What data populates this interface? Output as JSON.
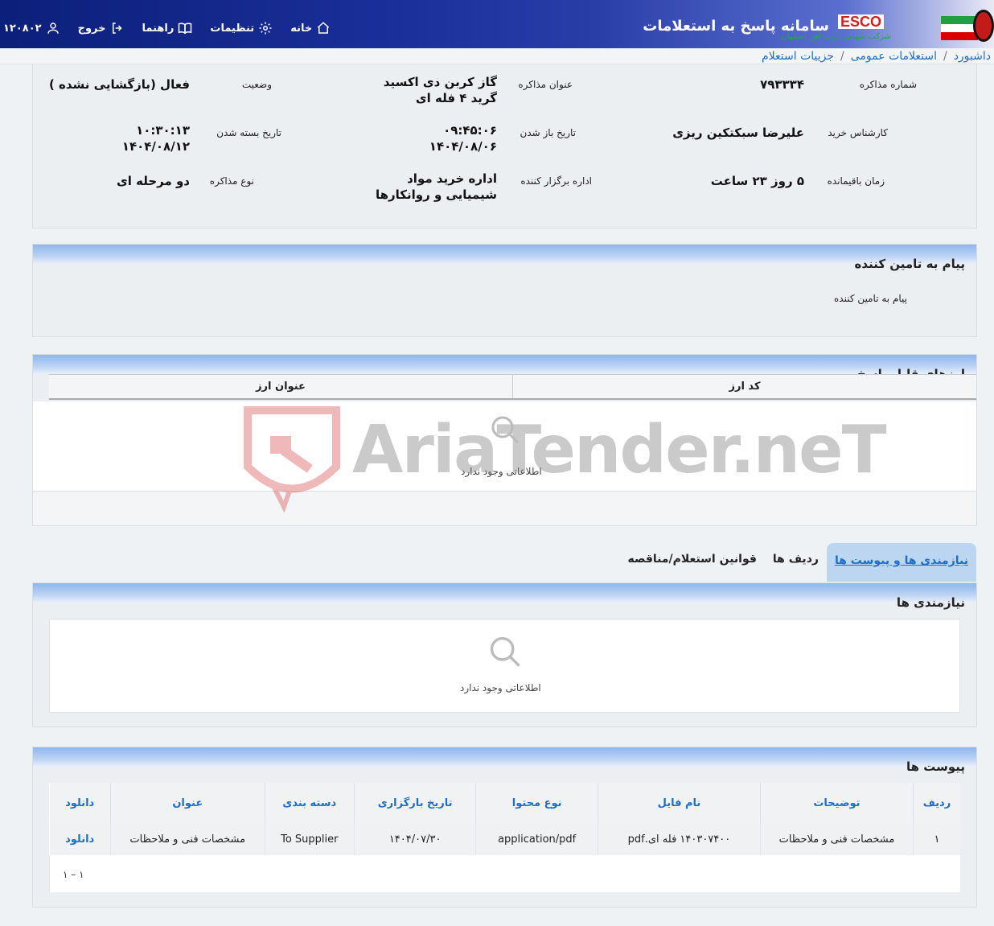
{
  "header": {
    "app_title": "سامانه پاسخ به استعلامات",
    "logo_text": "ESCO",
    "logo_subtitle": "شرکت سهامی ذوب آهن اصفهان",
    "nav": [
      {
        "label": "۱۲۰۸۰۲",
        "icon": "user-icon"
      },
      {
        "label": "خروج",
        "icon": "logout-icon"
      },
      {
        "label": "راهنما",
        "icon": "book-icon"
      },
      {
        "label": "تنظیمات",
        "icon": "gear-icon"
      },
      {
        "label": "خانه",
        "icon": "home-icon"
      }
    ]
  },
  "breadcrumb": [
    "داشبورد",
    "استعلامات عمومی",
    "جزییات استعلام"
  ],
  "details": {
    "negotiation_number": {
      "label": "شماره مذاکره",
      "value": "۷۹۳۳۳۴"
    },
    "negotiation_title": {
      "label": "عنوان مذاکره",
      "value": "گاز کربن دی اکسید گرید ۴ فله ای"
    },
    "status": {
      "label": "وضعیت",
      "value": "فعال (بازگشایی نشده )"
    },
    "buyer_expert": {
      "label": "کارشناس خرید",
      "value": "علیرضا سبکتکین ریزی"
    },
    "open_date": {
      "label": "تاریخ باز شدن",
      "time": "۰۹:۴۵:۰۶",
      "date": "۱۴۰۴/۰۸/۰۶"
    },
    "close_date": {
      "label": "تاریخ بسته شدن",
      "time": "۱۰:۳۰:۱۳",
      "date": "۱۴۰۴/۰۸/۱۲"
    },
    "remaining_time": {
      "label": "زمان باقیمانده",
      "value": "۵ روز ۲۳ ساعت"
    },
    "organizer": {
      "label": "اداره برگزار کننده",
      "value": "اداره خرید مواد شیمیایی و روانکارها"
    },
    "negotiation_type": {
      "label": "نوع مذاکره",
      "value": "دو مرحله ای"
    }
  },
  "message_panel": {
    "title": "پیام به تامین کننده",
    "body": "پیام به تامین کننده"
  },
  "currency_panel": {
    "title": "ارزهای قابل پاسخ",
    "columns": [
      "کد ارز",
      "عنوان ارز"
    ],
    "empty_text": "اطلاعاتی وجود ندارد"
  },
  "watermark": "AriaTender.neT",
  "tabs": [
    {
      "label": "نیازمندی ها و پیوست ها",
      "active": true
    },
    {
      "label": "ردیف ها",
      "active": false
    },
    {
      "label": "قوانین استعلام/مناقصه",
      "active": false
    }
  ],
  "needs_panel": {
    "title": "نیازمندی ها",
    "empty_text": "اطلاعاتی وجود ندارد"
  },
  "attachments_panel": {
    "title": "پیوست ها",
    "columns": [
      "ردیف",
      "توضیحات",
      "نام فایل",
      "نوع محتوا",
      "تاریخ بارگزاری",
      "دسته بندی",
      "عنوان",
      "دانلود"
    ],
    "rows": [
      {
        "row": "۱",
        "description": "مشخصات فنی و ملاحظات",
        "file_name": "۱۴۰۳۰۷۴۰۰ فله ای.pdf",
        "content_type": "application/pdf",
        "upload_date": "۱۴۰۴/۰۷/۳۰",
        "category": "To Supplier",
        "title": "مشخصات فنی و ملاحظات",
        "download": "دانلود"
      }
    ],
    "pager": "۱ – ۱"
  },
  "colors": {
    "accent": "#1e6ec8",
    "header_dark": "#0c1f7a",
    "panel_head": "#8fb6ec"
  }
}
